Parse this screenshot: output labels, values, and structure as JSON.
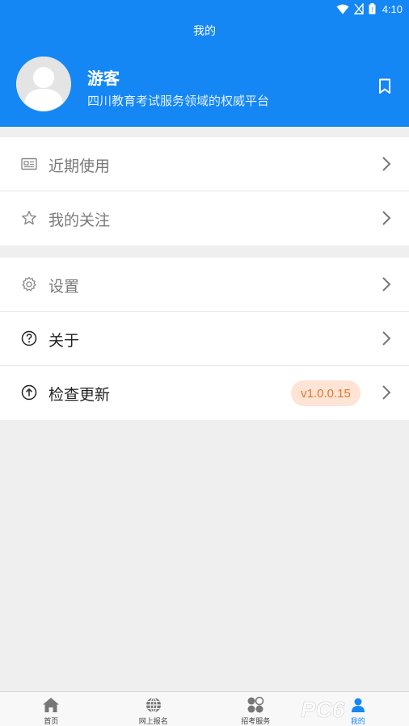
{
  "status_bar": {
    "time": "4:10"
  },
  "header": {
    "title": "我的",
    "user_name": "游客",
    "user_subtitle": "四川教育考试服务领域的权威平台"
  },
  "menu_group_1": [
    {
      "label": "近期使用",
      "icon": "news-icon"
    },
    {
      "label": "我的关注",
      "icon": "star-icon"
    }
  ],
  "menu_group_2": [
    {
      "label": "设置",
      "icon": "gear-icon"
    },
    {
      "label": "关于",
      "icon": "help-circle-icon"
    },
    {
      "label": "检查更新",
      "icon": "upload-circle-icon",
      "badge": "v1.0.0.15"
    }
  ],
  "tabbar": [
    {
      "label": "首页",
      "icon": "home-icon",
      "active": false
    },
    {
      "label": "网上报名",
      "icon": "globe-icon",
      "active": false
    },
    {
      "label": "招考服务",
      "icon": "grid-dots-icon",
      "active": false
    },
    {
      "label": "我的",
      "icon": "person-icon",
      "active": true
    }
  ],
  "watermark": "PC6",
  "colors": {
    "header_blue": "#1487f5",
    "badge_bg": "#fde4d4",
    "badge_text": "#e0762e",
    "page_bg": "#efefef"
  }
}
